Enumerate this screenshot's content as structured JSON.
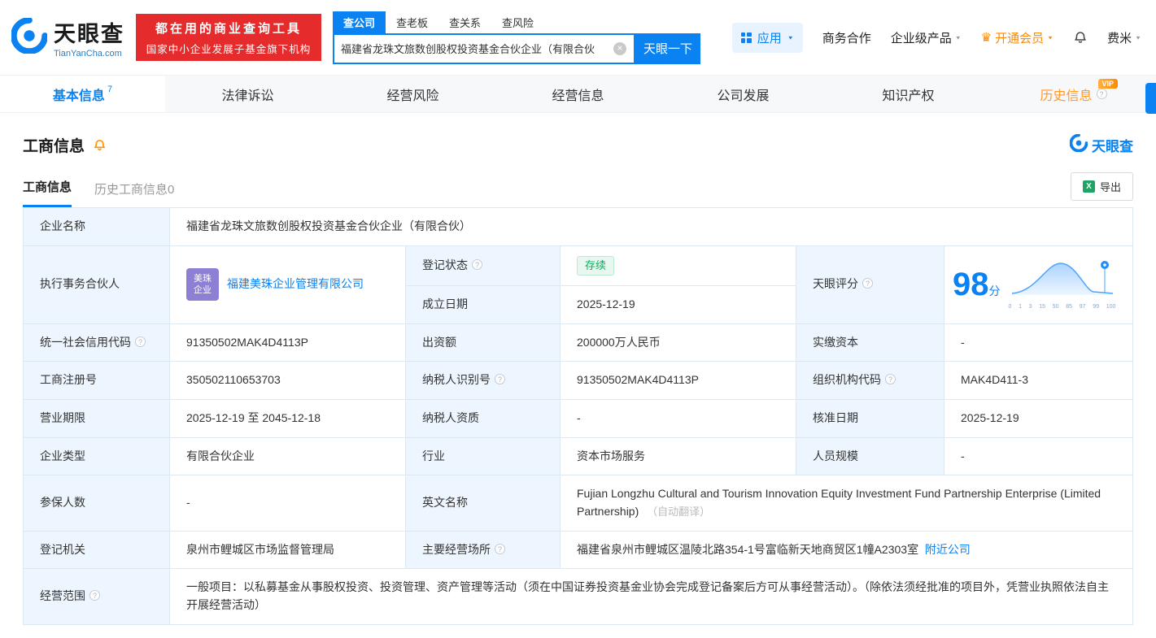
{
  "icons": {
    "caret": "▼",
    "clear": "×",
    "crown": "♛",
    "help": "?",
    "excel": "X"
  },
  "header": {
    "logo_title": "天眼查",
    "logo_domain": "TianYanCha.com",
    "banner_line1": "都在用的商业查询工具",
    "banner_line2": "国家中小企业发展子基金旗下机构",
    "search_tabs": [
      {
        "label": "查公司"
      },
      {
        "label": "查老板"
      },
      {
        "label": "查关系"
      },
      {
        "label": "查风险"
      }
    ],
    "search_value": "福建省龙珠文旅数创股权投资基金合伙企业（有限合伙",
    "search_button": "天眼一下"
  },
  "topnav": {
    "apps": "应用",
    "cooperation": "商务合作",
    "enterprise": "企业级产品",
    "membership": "开通会员",
    "username": "费米"
  },
  "nav_tabs": [
    {
      "label": "基本信息",
      "count": "7"
    },
    {
      "label": "法律诉讼"
    },
    {
      "label": "经营风险"
    },
    {
      "label": "经营信息"
    },
    {
      "label": "公司发展"
    },
    {
      "label": "知识产权"
    },
    {
      "label": "历史信息",
      "badge": "VIP"
    }
  ],
  "section": {
    "title": "工商信息",
    "watermark": "天眼查",
    "subtabs": [
      {
        "label": "工商信息"
      },
      {
        "label": "历史工商信息0"
      }
    ],
    "export_label": "导出"
  },
  "info": {
    "company_name": {
      "label": "企业名称",
      "value": "福建省龙珠文旅数创股权投资基金合伙企业（有限合伙）"
    },
    "managing_partner": {
      "label": "执行事务合伙人",
      "logo_line1": "美珠",
      "logo_line2": "企业",
      "value": "福建美珠企业管理有限公司"
    },
    "reg_status": {
      "label": "登记状态",
      "value": "存续"
    },
    "est_date": {
      "label": "成立日期",
      "value": "2025-12-19"
    },
    "score": {
      "label": "天眼评分",
      "value": "98",
      "unit": "分",
      "axis": [
        "0",
        "1",
        "3",
        "15",
        "50",
        "85",
        "97",
        "99",
        "100"
      ]
    },
    "credit_code": {
      "label": "统一社会信用代码",
      "value": "91350502MAK4D4113P"
    },
    "capital": {
      "label": "出资额",
      "value": "200000万人民币"
    },
    "paid_capital": {
      "label": "实缴资本",
      "value": "-"
    },
    "reg_number": {
      "label": "工商注册号",
      "value": "350502110653703"
    },
    "taxpayer_id": {
      "label": "纳税人识别号",
      "value": "91350502MAK4D4113P"
    },
    "org_code": {
      "label": "组织机构代码",
      "value": "MAK4D411-3"
    },
    "business_term": {
      "label": "营业期限",
      "value": "2025-12-19 至 2045-12-18"
    },
    "taxpayer_quality": {
      "label": "纳税人资质",
      "value": "-"
    },
    "approval_date": {
      "label": "核准日期",
      "value": "2025-12-19"
    },
    "company_type": {
      "label": "企业类型",
      "value": "有限合伙企业"
    },
    "industry": {
      "label": "行业",
      "value": "资本市场服务"
    },
    "staff_size": {
      "label": "人员规模",
      "value": "-"
    },
    "insured_count": {
      "label": "参保人数",
      "value": "-"
    },
    "english_name": {
      "label": "英文名称",
      "value": "Fujian Longzhu Cultural and Tourism Innovation Equity Investment Fund Partnership Enterprise (Limited Partnership)",
      "note": "（自动翻译）"
    },
    "reg_authority": {
      "label": "登记机关",
      "value": "泉州市鲤城区市场监督管理局"
    },
    "address": {
      "label": "主要经营场所",
      "value": "福建省泉州市鲤城区温陵北路354-1号富临新天地商贸区1幢A2303室",
      "link": "附近公司"
    },
    "business_scope": {
      "label": "经营范围",
      "value": "一般项目：以私募基金从事股权投资、投资管理、资产管理等活动（须在中国证券投资基金业协会完成登记备案后方可从事经营活动）。（除依法须经批准的项目外，凭营业执照依法自主开展经营活动）"
    }
  }
}
